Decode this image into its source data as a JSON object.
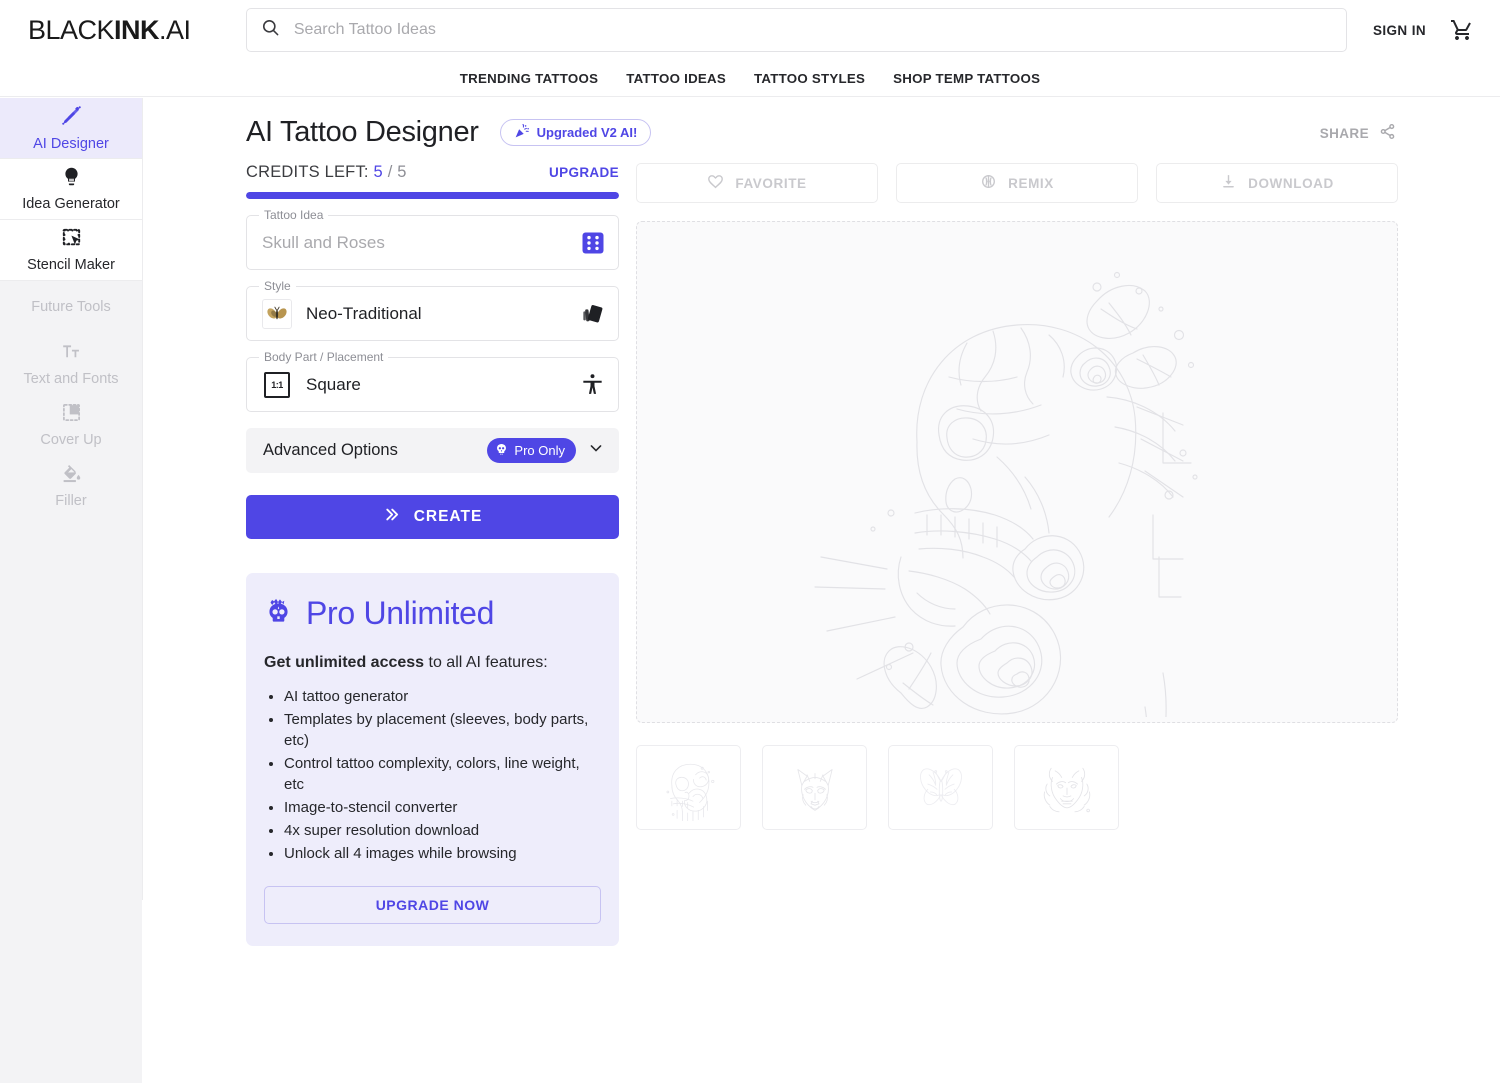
{
  "brand": {
    "part1": "BLACK",
    "part2": "INK",
    "part3": ".AI"
  },
  "header": {
    "search_placeholder": "Search Tattoo Ideas",
    "search_value": "",
    "sign_in": "SIGN IN",
    "search_icon": "search-icon",
    "cart_icon": "shopping-cart-icon"
  },
  "nav": {
    "items": [
      {
        "label": "TRENDING TATTOOS"
      },
      {
        "label": "TATTOO IDEAS"
      },
      {
        "label": "TATTOO STYLES"
      },
      {
        "label": "SHOP TEMP TATTOOS"
      }
    ]
  },
  "sidebar": {
    "items": [
      {
        "label": "AI Designer",
        "icon": "tattoo-machine-icon",
        "active": true
      },
      {
        "label": "Idea Generator",
        "icon": "lightbulb-icon",
        "active": false
      },
      {
        "label": "Stencil Maker",
        "icon": "stencil-select-icon",
        "active": false
      }
    ],
    "future_heading": "Future Tools",
    "future_items": [
      {
        "label": "Text and Fonts",
        "icon": "text-format-icon"
      },
      {
        "label": "Cover Up",
        "icon": "cover-up-icon"
      },
      {
        "label": "Filler",
        "icon": "paint-bucket-icon"
      }
    ]
  },
  "page": {
    "title": "AI Tattoo Designer",
    "badge": "Upgraded V2 AI!",
    "badge_icon": "party-popper-icon",
    "share_label": "SHARE",
    "share_icon": "share-icon"
  },
  "credits": {
    "label": "CREDITS LEFT:",
    "current": "5",
    "separator": "/",
    "total": "5",
    "upgrade_label": "UPGRADE",
    "progress_percent": 100
  },
  "form": {
    "tattoo_idea": {
      "label": "Tattoo Idea",
      "value": "",
      "placeholder": "Skull and Roses",
      "action_icon": "dice-icon"
    },
    "style": {
      "label": "Style",
      "value": "Neo-Traditional",
      "thumb_icon": "butterfly-thumbnail",
      "action_icon": "style-cards-icon"
    },
    "body_part": {
      "label": "Body Part / Placement",
      "value": "Square",
      "thumb_icon": "aspect-ratio-1-1-icon",
      "ratio_text": "1:1",
      "action_icon": "body-placement-icon"
    },
    "advanced": {
      "label": "Advanced Options",
      "badge": "Pro Only",
      "badge_icon": "skull-icon",
      "chevron_icon": "chevron-down-icon"
    },
    "create_button": {
      "label": "CREATE",
      "icon": "double-chevron-right-icon"
    }
  },
  "pro_card": {
    "title": "Pro Unlimited",
    "title_icon": "crowned-skull-icon",
    "subtitle_bold": "Get unlimited access",
    "subtitle_rest": " to all AI features:",
    "features": [
      "AI tattoo generator",
      "Templates by placement (sleeves, body parts, etc)",
      "Control tattoo complexity, colors, line weight, etc",
      "Image-to-stencil converter",
      "4x super resolution download",
      "Unlock all 4 images while browsing"
    ],
    "cta": "UPGRADE NOW"
  },
  "actions": [
    {
      "label": "FAVORITE",
      "icon": "heart-icon",
      "disabled": true
    },
    {
      "label": "REMIX",
      "icon": "remix-icon",
      "disabled": true
    },
    {
      "label": "DOWNLOAD",
      "icon": "download-icon",
      "disabled": true
    }
  ],
  "preview": {
    "artwork": "skull-and-roses-placeholder",
    "state": "placeholder"
  },
  "thumbnails": [
    {
      "artwork": "skull-thumbnail"
    },
    {
      "artwork": "wolf-thumbnail"
    },
    {
      "artwork": "butterfly-thumbnail"
    },
    {
      "artwork": "oni-mask-thumbnail"
    }
  ],
  "colors": {
    "accent": "#4F46E5",
    "accent_soft": "#EEEDFB",
    "text": "#1F2024",
    "muted": "#A9A9AD",
    "border": "#E3E3E6"
  }
}
